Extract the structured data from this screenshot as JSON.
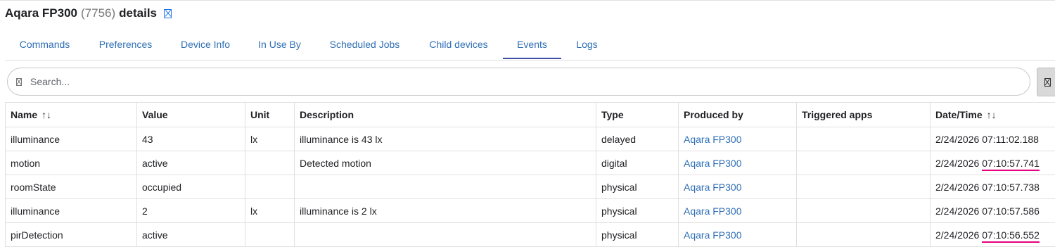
{
  "header": {
    "device_name": "Aqara FP300",
    "device_id": "(7756)",
    "suffix": "details",
    "edit_icon": "edit-icon"
  },
  "tabs": [
    {
      "label": "Commands",
      "active": false
    },
    {
      "label": "Preferences",
      "active": false
    },
    {
      "label": "Device Info",
      "active": false
    },
    {
      "label": "In Use By",
      "active": false
    },
    {
      "label": "Scheduled Jobs",
      "active": false
    },
    {
      "label": "Child devices",
      "active": false
    },
    {
      "label": "Events",
      "active": true
    },
    {
      "label": "Logs",
      "active": false
    }
  ],
  "search": {
    "placeholder": "Search...",
    "value": ""
  },
  "table": {
    "columns": [
      "Name",
      "Value",
      "Unit",
      "Description",
      "Type",
      "Produced by",
      "Triggered apps",
      "Date/Time"
    ],
    "sortable_columns": [
      "Name",
      "Date/Time"
    ],
    "rows": [
      {
        "name": "illuminance",
        "value": "43",
        "unit": "lx",
        "description": "illuminance is 43 lx",
        "type": "delayed",
        "produced_by": "Aqara FP300",
        "triggered_apps": "",
        "date": "2/24/2026",
        "time": "07:11:02.188",
        "time_underlined": false
      },
      {
        "name": "motion",
        "value": "active",
        "unit": "",
        "description": "Detected motion",
        "type": "digital",
        "produced_by": "Aqara FP300",
        "triggered_apps": "",
        "date": "2/24/2026",
        "time": "07:10:57.741",
        "time_underlined": true
      },
      {
        "name": "roomState",
        "value": "occupied",
        "unit": "",
        "description": "",
        "type": "physical",
        "produced_by": "Aqara FP300",
        "triggered_apps": "",
        "date": "2/24/2026",
        "time": "07:10:57.738",
        "time_underlined": false
      },
      {
        "name": "illuminance",
        "value": "2",
        "unit": "lx",
        "description": "illuminance is 2 lx",
        "type": "physical",
        "produced_by": "Aqara FP300",
        "triggered_apps": "",
        "date": "2/24/2026",
        "time": "07:10:57.586",
        "time_underlined": false
      },
      {
        "name": "pirDetection",
        "value": "active",
        "unit": "",
        "description": "",
        "type": "physical",
        "produced_by": "Aqara FP300",
        "triggered_apps": "",
        "date": "2/24/2026",
        "time": "07:10:56.552",
        "time_underlined": true
      }
    ]
  },
  "colors": {
    "link": "#2f6fb5",
    "active_tab_underline": "#3f51a5",
    "annotation_underline": "#e6007e"
  }
}
